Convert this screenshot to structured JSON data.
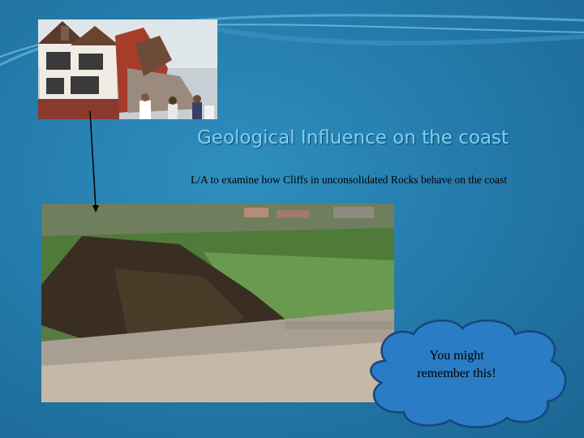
{
  "slide": {
    "title": "Geological Influence on the coast",
    "subtitle": "L/A to examine how Cliffs in unconsolidated Rocks behave on the coast",
    "callout": {
      "line1": "You might",
      "line2": "remember this!"
    }
  },
  "images": {
    "house": "collapsing-house-photo",
    "cliff": "coastal-landslide-photo"
  },
  "colors": {
    "background": "#2378a8",
    "title": "#7fd0f2",
    "callout_fill": "#2a7cc4",
    "callout_border": "#16467e"
  }
}
